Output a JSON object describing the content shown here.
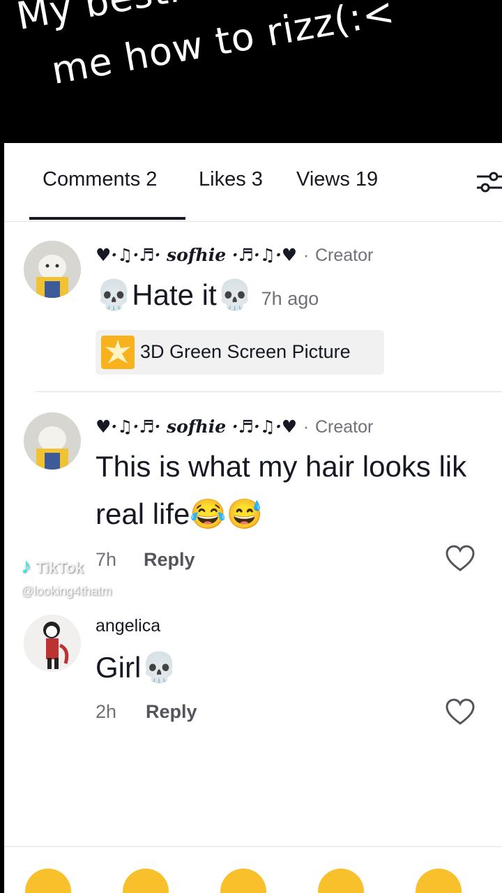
{
  "caption": {
    "line1": "My bestie teachin",
    "line2": "me how to rizz(:<"
  },
  "tabs": [
    {
      "label": "Comments 2",
      "active": true
    },
    {
      "label": "Likes 3",
      "active": false
    },
    {
      "label": "Views 19",
      "active": false
    }
  ],
  "comments": [
    {
      "username": "♥·♫·♬· sofhie ·♬·♫·♥",
      "badge_sep": "·",
      "badge": "Creator",
      "text": "💀Hate it💀",
      "time": "7h ago",
      "chip": {
        "label": "3D Green Screen Picture",
        "icon": "effect-icon"
      }
    },
    {
      "username": "♥·♫·♬· sofhie ·♬·♫·♥",
      "badge_sep": "·",
      "badge": "Creator",
      "text_line1": "This is what my hair looks lik",
      "text_line2": "real life😂😅",
      "time": "7h",
      "reply": "Reply"
    },
    {
      "username": "angelica",
      "text": "Girl💀",
      "time": "2h",
      "reply": "Reply"
    }
  ],
  "watermark": {
    "brand": "TikTok",
    "handle": "@looking4thatm"
  },
  "colors": {
    "accent": "#161823",
    "muted": "#70707a",
    "chip_bg": "#f1f1f2"
  }
}
